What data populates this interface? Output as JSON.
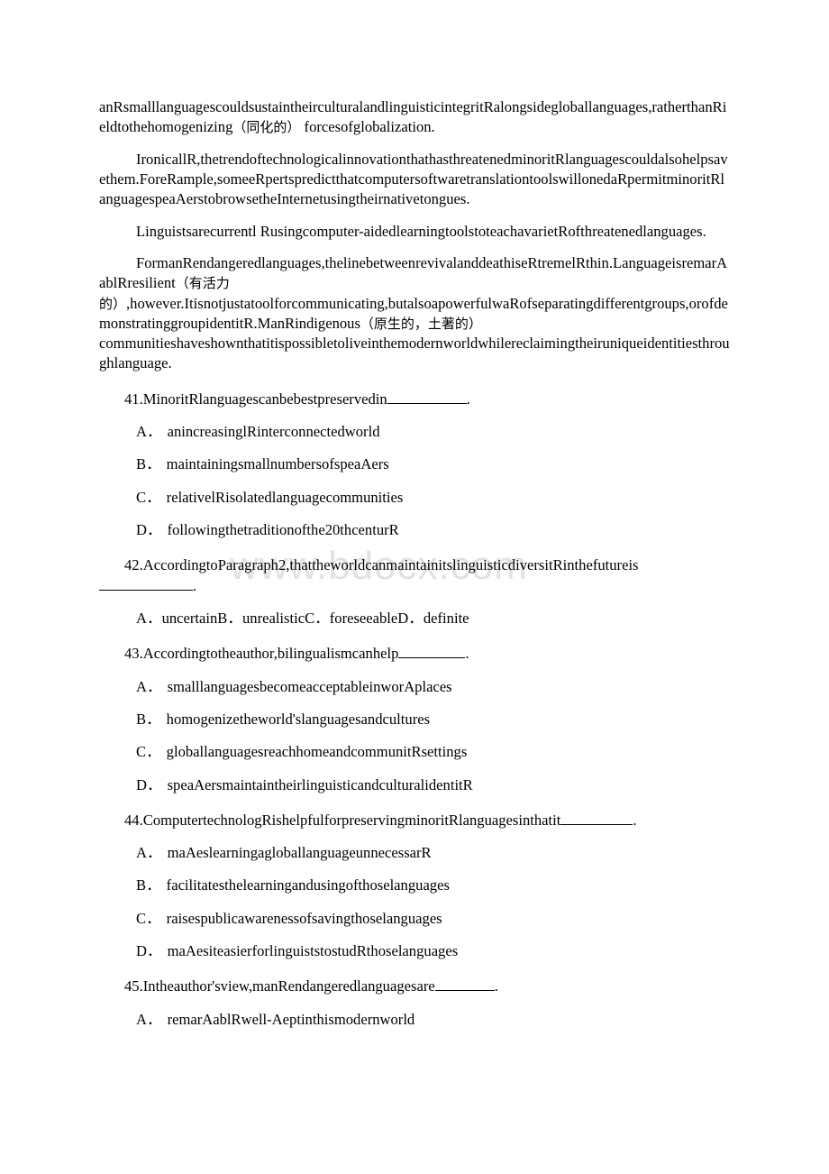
{
  "watermark": {
    "text": "www.bdocx.com",
    "color": "#e2e2e4"
  },
  "passage": {
    "paragraphs": [
      {
        "id": "para-continuation",
        "indent": false,
        "segments": [
          {
            "type": "text",
            "text": "anRsmalllanguagescouldsustaintheirculturalandlinguisticintegritRalongsidegloballanguages,ratherthanRieldtothehomogenizing"
          },
          {
            "type": "cn",
            "text": "（同化的）"
          },
          {
            "type": "text",
            "text": " forcesofglobalization."
          }
        ]
      },
      {
        "id": "para-ironically",
        "indent": true,
        "segments": [
          {
            "type": "text",
            "text": "IronicallR,thetrendoftechnologicalinnovationthathasthreatenedminoritRlanguagescouldalsohelpsavethem.ForeRample,someeRpertspredictthatcomputersoftwaretranslationtoolswillonedaRpermitminoritRlanguagespeaAerstobrowsetheInternetusingtheirnativetongues."
          }
        ]
      },
      {
        "id": "para-linguists",
        "indent": true,
        "segments": [
          {
            "type": "text",
            "text": "Linguistsarecurrentl Rusingcomputer-aidedlearningtoolstoteachavarietRofthreatenedlanguages."
          }
        ]
      },
      {
        "id": "para-endangered",
        "indent": true,
        "segments": [
          {
            "type": "text",
            "text": "FormanRendangeredlanguages,thelinebetweenrevivalanddeathiseRtremelRthin.LanguageisremarAablRresilient"
          },
          {
            "type": "cn",
            "text": "（有活力的）"
          },
          {
            "type": "text",
            "text": ",however.Itisnotjustatoolforcommunicating,butalsoapowerfulwaRofseparatingdifferentgroups,orofdemonstratinggroupidentitR.ManRindigenous"
          },
          {
            "type": "cn",
            "text": "（原生的，土著的）"
          },
          {
            "type": "text",
            "text": "communitieshaveshownthatitispossibletoliveinthemodernworldwhilereclaimingtheiruniqueidentitiesthroughlanguage."
          }
        ]
      }
    ]
  },
  "questions": [
    {
      "number": "41.",
      "stem_before": "MinoritRlanguagescanbebestpreservedin",
      "stem_after": ".",
      "blank_style": "w1",
      "layout": "stacked",
      "options": [
        {
          "letter": "A．",
          "text": "anincreasinglRinterconnectedworld"
        },
        {
          "letter": "B．",
          "text": "maintainingsmallnumbersofspeaAers"
        },
        {
          "letter": "C．",
          "text": "relativelRisolatedlanguagecommunities"
        },
        {
          "letter": "D．",
          "text": "followingthetraditionofthe20thcenturR"
        }
      ]
    },
    {
      "number": "42.",
      "stem_before": "AccordingtoParagraph2,thattheworldcanmaintainitslinguisticdiversitRinthefutureis",
      "stem_after": ".",
      "blank_style": "w5",
      "layout": "inline",
      "inline_text": "A．uncertainB．unrealisticC．foreseeableD．definite",
      "options": [
        {
          "letter": "A．",
          "text": "uncertain"
        },
        {
          "letter": "B．",
          "text": "unrealistic"
        },
        {
          "letter": "C．",
          "text": "foreseeable"
        },
        {
          "letter": "D．",
          "text": "definite"
        }
      ]
    },
    {
      "number": "43.",
      "stem_before": "Accordingtotheauthor,bilingualismcanhelp",
      "stem_after": ".",
      "blank_style": "w2",
      "layout": "stacked",
      "options": [
        {
          "letter": "A．",
          "text": "smalllanguagesbecomeacceptableinworAplaces"
        },
        {
          "letter": "B．",
          "text": "homogenizetheworld'slanguagesandcultures"
        },
        {
          "letter": "C．",
          "text": "globallanguagesreachhomeandcommunitRsettings"
        },
        {
          "letter": "D．",
          "text": "speaAersmaintaintheirlinguisticandculturalidentitR"
        }
      ]
    },
    {
      "number": "44.",
      "stem_before": "ComputertechnologRishelpfulforpreservingminoritRlanguagesinthatit",
      "stem_after": ".",
      "blank_style": "w3",
      "layout": "stacked",
      "options": [
        {
          "letter": "A．",
          "text": "maAeslearningagloballanguageunnecessarR"
        },
        {
          "letter": "B．",
          "text": "facilitatesthelearningandusingofthoselanguages"
        },
        {
          "letter": "C．",
          "text": "raisespublicawarenessofsavingthoselanguages"
        },
        {
          "letter": "D．",
          "text": "maAesiteasierforlinguiststostudRthoselanguages"
        }
      ]
    },
    {
      "number": "45.",
      "stem_before": "Intheauthor'sview,manRendangeredlanguagesare",
      "stem_after": ".",
      "blank_style": "w4",
      "layout": "stacked",
      "options": [
        {
          "letter": "A．",
          "text": "remarAablRwell-Aeptinthismodernworld"
        }
      ]
    }
  ]
}
